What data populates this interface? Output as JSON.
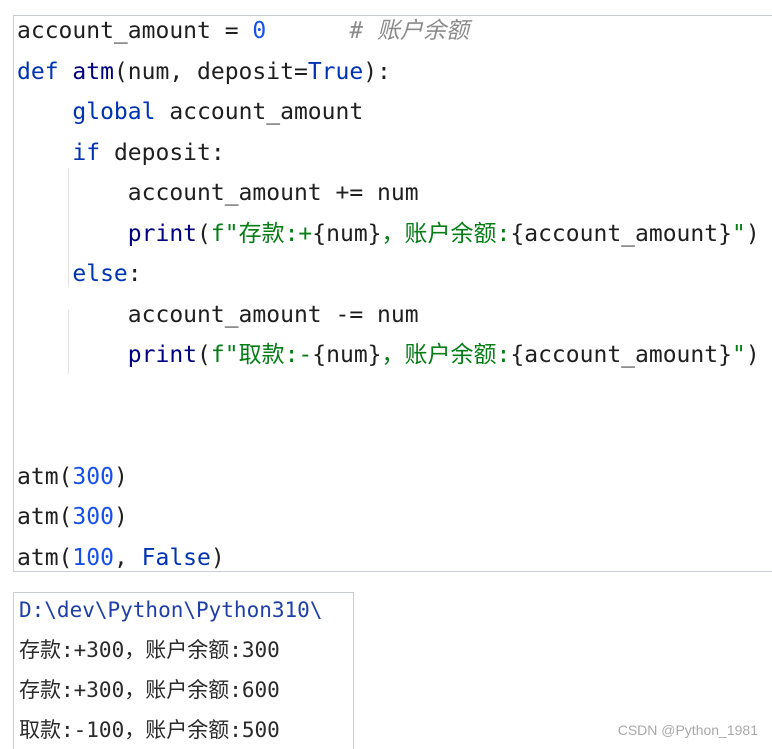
{
  "colors": {
    "keyword": "#0033b3",
    "builtin": "#000080",
    "number": "#1750eb",
    "string": "#067d17",
    "comment": "#8c8c8c",
    "plain": "#1f1f1f"
  },
  "code_lines": [
    [
      {
        "t": "account_amount = ",
        "c": "plain"
      },
      {
        "t": "0",
        "c": "number"
      },
      {
        "t": "      # 账户余额",
        "c": "comment"
      }
    ],
    [
      {
        "t": "def ",
        "c": "keyword"
      },
      {
        "t": "atm",
        "c": "builtin"
      },
      {
        "t": "(num, deposit=",
        "c": "plain"
      },
      {
        "t": "True",
        "c": "keyword"
      },
      {
        "t": "):",
        "c": "plain"
      }
    ],
    [
      {
        "t": "    ",
        "c": "plain"
      },
      {
        "t": "global",
        "c": "keyword"
      },
      {
        "t": " account_amount",
        "c": "plain"
      }
    ],
    [
      {
        "t": "    ",
        "c": "plain"
      },
      {
        "t": "if",
        "c": "keyword"
      },
      {
        "t": " deposit:",
        "c": "plain"
      }
    ],
    [
      {
        "t": "        account_amount += num",
        "c": "plain"
      }
    ],
    [
      {
        "t": "        ",
        "c": "plain"
      },
      {
        "t": "print",
        "c": "builtin"
      },
      {
        "t": "(",
        "c": "plain"
      },
      {
        "t": "f\"存款:+",
        "c": "string"
      },
      {
        "t": "{num}",
        "c": "plain"
      },
      {
        "t": "，账户余额:",
        "c": "string"
      },
      {
        "t": "{account_amount}",
        "c": "plain"
      },
      {
        "t": "\"",
        "c": "string"
      },
      {
        "t": ")",
        "c": "plain"
      }
    ],
    [
      {
        "t": "    ",
        "c": "plain"
      },
      {
        "t": "else",
        "c": "keyword"
      },
      {
        "t": ":",
        "c": "plain"
      }
    ],
    [
      {
        "t": "        account_amount -= num",
        "c": "plain"
      }
    ],
    [
      {
        "t": "        ",
        "c": "plain"
      },
      {
        "t": "print",
        "c": "builtin"
      },
      {
        "t": "(",
        "c": "plain"
      },
      {
        "t": "f\"取款:-",
        "c": "string"
      },
      {
        "t": "{num}",
        "c": "plain"
      },
      {
        "t": "，账户余额:",
        "c": "string"
      },
      {
        "t": "{account_amount}",
        "c": "plain"
      },
      {
        "t": "\"",
        "c": "string"
      },
      {
        "t": ")",
        "c": "plain"
      }
    ],
    [],
    [],
    [
      {
        "t": "atm(",
        "c": "plain"
      },
      {
        "t": "300",
        "c": "number"
      },
      {
        "t": ")",
        "c": "plain"
      }
    ],
    [
      {
        "t": "atm(",
        "c": "plain"
      },
      {
        "t": "300",
        "c": "number"
      },
      {
        "t": ")",
        "c": "plain"
      }
    ],
    [
      {
        "t": "atm(",
        "c": "plain"
      },
      {
        "t": "100",
        "c": "number"
      },
      {
        "t": ", ",
        "c": "plain"
      },
      {
        "t": "False",
        "c": "keyword"
      },
      {
        "t": ")",
        "c": "plain"
      }
    ]
  ],
  "output_lines": [
    "D:\\dev\\Python\\Python310\\",
    "存款:+300，账户余额:300",
    "存款:+300，账户余额:600",
    "取款:-100，账户余额:500"
  ],
  "watermark": "CSDN @Python_1981"
}
